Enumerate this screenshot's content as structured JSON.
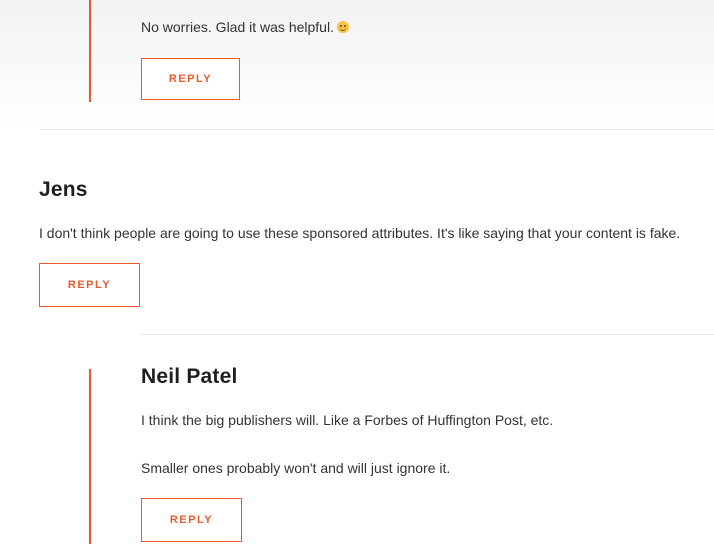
{
  "comments": [
    {
      "author": "",
      "paragraphs": [
        "No worries. Glad it was helpful."
      ],
      "emoji": "smiley-icon",
      "reply_label": "REPLY"
    },
    {
      "author": "Jens",
      "paragraphs": [
        "I don't think people are going to use these sponsored attributes. It's like saying that your content is fake."
      ],
      "reply_label": "REPLY"
    },
    {
      "author": "Neil Patel",
      "paragraphs": [
        "I think the big publishers will. Like a Forbes of Huffington Post, etc.",
        "Smaller ones probably won't and will just ignore it."
      ],
      "reply_label": "REPLY"
    }
  ],
  "colors": {
    "accent": "#e85a2c",
    "text": "#333333",
    "divider": "#e9e9e9"
  }
}
